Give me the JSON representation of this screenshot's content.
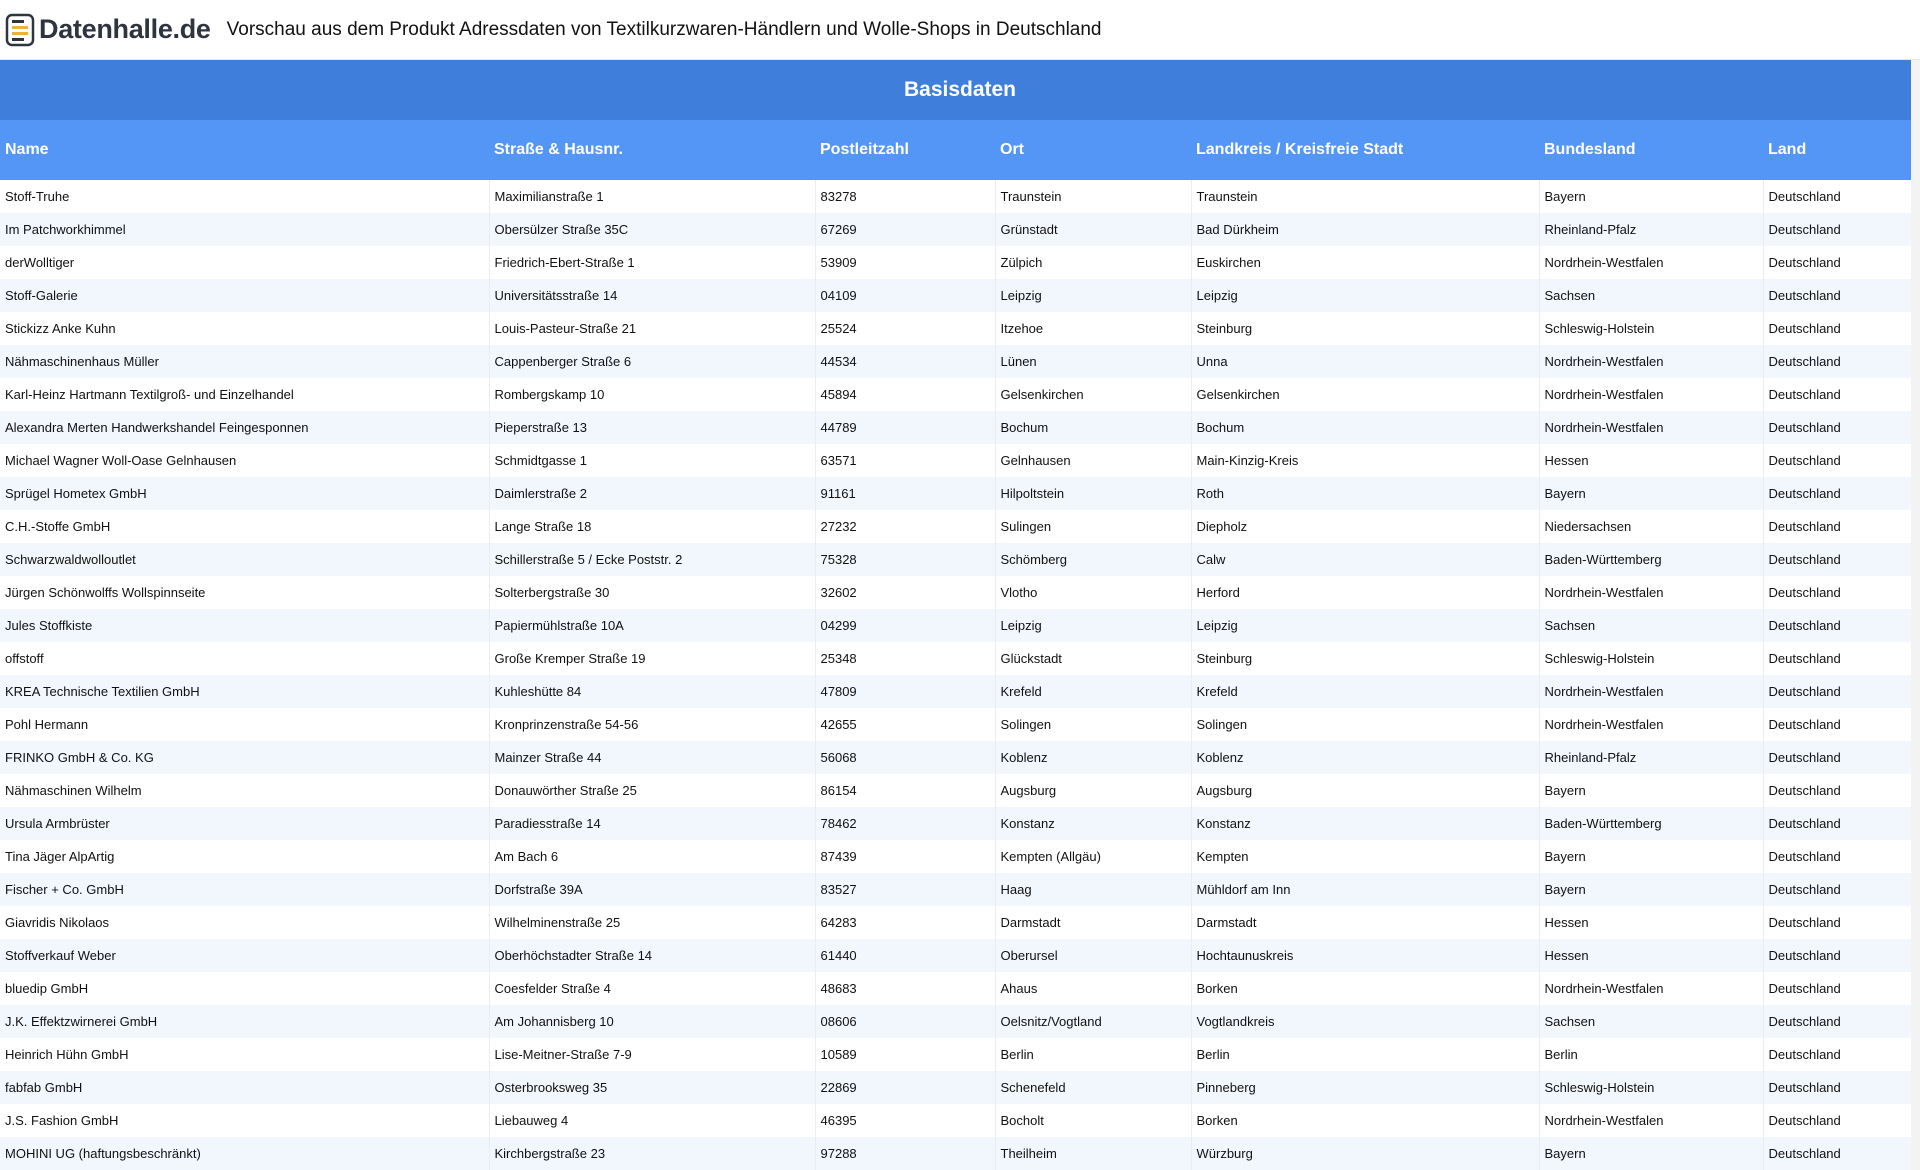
{
  "header": {
    "logo_text": "Datenhalle.de",
    "title": "Vorschau aus dem Produkt Adressdaten von Textilkurzwaren-Händlern und Wolle-Shops in Deutschland"
  },
  "section": {
    "title": "Basisdaten"
  },
  "colors": {
    "band": "#3f7fdb",
    "header": "#5496f6",
    "row_alt": "#f2f6fd"
  },
  "table": {
    "columns": [
      "Name",
      "Straße & Hausnr.",
      "Postleitzahl",
      "Ort",
      "Landkreis / Kreisfreie Stadt",
      "Bundesland",
      "Land"
    ],
    "rows": [
      [
        "Stoff-Truhe",
        "Maximilianstraße 1",
        "83278",
        "Traunstein",
        "Traunstein",
        "Bayern",
        "Deutschland"
      ],
      [
        "Im Patchworkhimmel",
        "Obersülzer Straße 35C",
        "67269",
        "Grünstadt",
        "Bad Dürkheim",
        "Rheinland-Pfalz",
        "Deutschland"
      ],
      [
        "derWolltiger",
        "Friedrich-Ebert-Straße 1",
        "53909",
        "Zülpich",
        "Euskirchen",
        "Nordrhein-Westfalen",
        "Deutschland"
      ],
      [
        "Stoff-Galerie",
        "Universitätsstraße 14",
        "04109",
        "Leipzig",
        "Leipzig",
        "Sachsen",
        "Deutschland"
      ],
      [
        "Stickizz Anke Kuhn",
        "Louis-Pasteur-Straße 21",
        "25524",
        "Itzehoe",
        "Steinburg",
        "Schleswig-Holstein",
        "Deutschland"
      ],
      [
        "Nähmaschinenhaus Müller",
        "Cappenberger Straße 6",
        "44534",
        "Lünen",
        "Unna",
        "Nordrhein-Westfalen",
        "Deutschland"
      ],
      [
        "Karl-Heinz Hartmann Textilgroß- und Einzelhandel",
        "Rombergskamp 10",
        "45894",
        "Gelsenkirchen",
        "Gelsenkirchen",
        "Nordrhein-Westfalen",
        "Deutschland"
      ],
      [
        "Alexandra Merten Handwerkshandel Feingesponnen",
        "Pieperstraße 13",
        "44789",
        "Bochum",
        "Bochum",
        "Nordrhein-Westfalen",
        "Deutschland"
      ],
      [
        "Michael Wagner Woll-Oase Gelnhausen",
        "Schmidtgasse 1",
        "63571",
        "Gelnhausen",
        "Main-Kinzig-Kreis",
        "Hessen",
        "Deutschland"
      ],
      [
        "Sprügel Hometex GmbH",
        "Daimlerstraße 2",
        "91161",
        "Hilpoltstein",
        "Roth",
        "Bayern",
        "Deutschland"
      ],
      [
        "C.H.-Stoffe GmbH",
        "Lange Straße 18",
        "27232",
        "Sulingen",
        "Diepholz",
        "Niedersachsen",
        "Deutschland"
      ],
      [
        "Schwarzwaldwolloutlet",
        "Schillerstraße 5 / Ecke Poststr. 2",
        "75328",
        "Schömberg",
        "Calw",
        "Baden-Württemberg",
        "Deutschland"
      ],
      [
        "Jürgen Schönwolffs Wollspinnseite",
        "Solterbergstraße 30",
        "32602",
        "Vlotho",
        "Herford",
        "Nordrhein-Westfalen",
        "Deutschland"
      ],
      [
        "Jules Stoffkiste",
        "Papiermühlstraße 10A",
        "04299",
        "Leipzig",
        "Leipzig",
        "Sachsen",
        "Deutschland"
      ],
      [
        "offstoff",
        "Große Kremper Straße 19",
        "25348",
        "Glückstadt",
        "Steinburg",
        "Schleswig-Holstein",
        "Deutschland"
      ],
      [
        "KREA Technische Textilien GmbH",
        "Kuhleshütte 84",
        "47809",
        "Krefeld",
        "Krefeld",
        "Nordrhein-Westfalen",
        "Deutschland"
      ],
      [
        "Pohl Hermann",
        "Kronprinzenstraße 54-56",
        "42655",
        "Solingen",
        "Solingen",
        "Nordrhein-Westfalen",
        "Deutschland"
      ],
      [
        "FRINKO GmbH & Co. KG",
        "Mainzer Straße 44",
        "56068",
        "Koblenz",
        "Koblenz",
        "Rheinland-Pfalz",
        "Deutschland"
      ],
      [
        "Nähmaschinen Wilhelm",
        "Donauwörther Straße 25",
        "86154",
        "Augsburg",
        "Augsburg",
        "Bayern",
        "Deutschland"
      ],
      [
        "Ursula Armbrüster",
        "Paradiesstraße 14",
        "78462",
        "Konstanz",
        "Konstanz",
        "Baden-Württemberg",
        "Deutschland"
      ],
      [
        "Tina Jäger AlpArtig",
        "Am Bach 6",
        "87439",
        "Kempten (Allgäu)",
        "Kempten",
        "Bayern",
        "Deutschland"
      ],
      [
        "Fischer + Co. GmbH",
        "Dorfstraße 39A",
        "83527",
        "Haag",
        "Mühldorf am Inn",
        "Bayern",
        "Deutschland"
      ],
      [
        "Giavridis Nikolaos",
        "Wilhelminenstraße 25",
        "64283",
        "Darmstadt",
        "Darmstadt",
        "Hessen",
        "Deutschland"
      ],
      [
        "Stoffverkauf Weber",
        "Oberhöchstadter Straße 14",
        "61440",
        "Oberursel",
        "Hochtaunuskreis",
        "Hessen",
        "Deutschland"
      ],
      [
        "bluedip GmbH",
        "Coesfelder Straße 4",
        "48683",
        "Ahaus",
        "Borken",
        "Nordrhein-Westfalen",
        "Deutschland"
      ],
      [
        "J.K. Effektzwirnerei GmbH",
        "Am Johannisberg 10",
        "08606",
        "Oelsnitz/Vogtland",
        "Vogtlandkreis",
        "Sachsen",
        "Deutschland"
      ],
      [
        "Heinrich Hühn GmbH",
        "Lise-Meitner-Straße 7-9",
        "10589",
        "Berlin",
        "Berlin",
        "Berlin",
        "Deutschland"
      ],
      [
        "fabfab GmbH",
        "Osterbrooksweg 35",
        "22869",
        "Schenefeld",
        "Pinneberg",
        "Schleswig-Holstein",
        "Deutschland"
      ],
      [
        "J.S. Fashion GmbH",
        "Liebauweg 4",
        "46395",
        "Bocholt",
        "Borken",
        "Nordrhein-Westfalen",
        "Deutschland"
      ],
      [
        "MOHINI UG (haftungsbeschränkt)",
        "Kirchbergstraße 23",
        "97288",
        "Theilheim",
        "Würzburg",
        "Bayern",
        "Deutschland"
      ]
    ]
  }
}
